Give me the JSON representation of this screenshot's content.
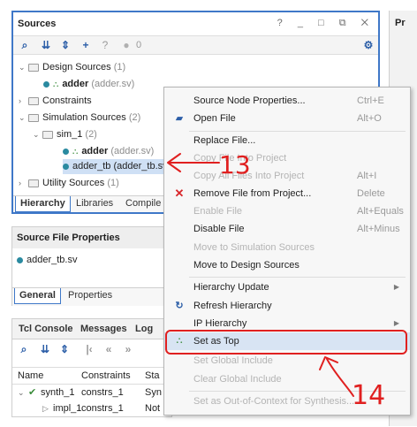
{
  "sources": {
    "title": "Sources",
    "title_controls": "? _ □ ⧉ ✕",
    "toolbar_count": "0",
    "tree": [
      {
        "label": "Design Sources",
        "count": "(1)"
      },
      {
        "label": "adder",
        "file": "(adder.sv)"
      },
      {
        "label": "Constraints"
      },
      {
        "label": "Simulation Sources",
        "count": "(2)"
      },
      {
        "label": "sim_1",
        "count": "(2)"
      },
      {
        "label": "adder",
        "file": "(adder.sv)"
      },
      {
        "label": "adder_tb",
        "file": "(adder_tb.sv)"
      },
      {
        "label": "Utility Sources",
        "count": "(1)"
      }
    ],
    "tabs": [
      "Hierarchy",
      "Libraries",
      "Compile O"
    ]
  },
  "right_panel_title": "Pr",
  "properties": {
    "title": "Source File Properties",
    "file": "adder_tb.sv",
    "tabs": [
      "General",
      "Properties"
    ]
  },
  "tcl": {
    "tabs": [
      "Tcl Console",
      "Messages",
      "Log"
    ],
    "columns": [
      "Name",
      "Constraints",
      "Sta"
    ],
    "rows": [
      {
        "name": "synth_1",
        "constraints": "constrs_1",
        "status": "Syn"
      },
      {
        "name": "impl_1",
        "constraints": "constrs_1",
        "status": "Not"
      }
    ]
  },
  "menu": {
    "items": [
      {
        "label": "Source Node Properties...",
        "shortcut": "Ctrl+E",
        "disabled": false
      },
      {
        "label": "Open File",
        "shortcut": "Alt+O",
        "disabled": false
      },
      {
        "label": "Replace File...",
        "shortcut": "",
        "disabled": false
      },
      {
        "label": "Copy File Into Project",
        "shortcut": "",
        "disabled": true
      },
      {
        "label": "Copy All Files Into Project",
        "shortcut": "Alt+I",
        "disabled": true
      },
      {
        "label": "Remove File from Project...",
        "shortcut": "Delete",
        "disabled": false
      },
      {
        "label": "Enable File",
        "shortcut": "Alt+Equals",
        "disabled": true
      },
      {
        "label": "Disable File",
        "shortcut": "Alt+Minus",
        "disabled": false
      },
      {
        "label": "Move to Simulation Sources",
        "shortcut": "",
        "disabled": true
      },
      {
        "label": "Move to Design Sources",
        "shortcut": "",
        "disabled": false
      },
      {
        "label": "Hierarchy Update",
        "shortcut": "",
        "disabled": false
      },
      {
        "label": "Refresh Hierarchy",
        "shortcut": "",
        "disabled": false
      },
      {
        "label": "IP Hierarchy",
        "shortcut": "",
        "disabled": false
      },
      {
        "label": "Set as Top",
        "shortcut": "",
        "disabled": false
      },
      {
        "label": "Set Global Include",
        "shortcut": "",
        "disabled": true
      },
      {
        "label": "Clear Global Include",
        "shortcut": "",
        "disabled": true
      },
      {
        "label": "Set as Out-of-Context for Synthesis...",
        "shortcut": "",
        "disabled": true
      }
    ]
  },
  "annotations": {
    "step13": "13",
    "step14": "14"
  },
  "colors": {
    "annotation": "#e02020",
    "selection": "#cfe0f5",
    "accent": "#3f78c8"
  }
}
